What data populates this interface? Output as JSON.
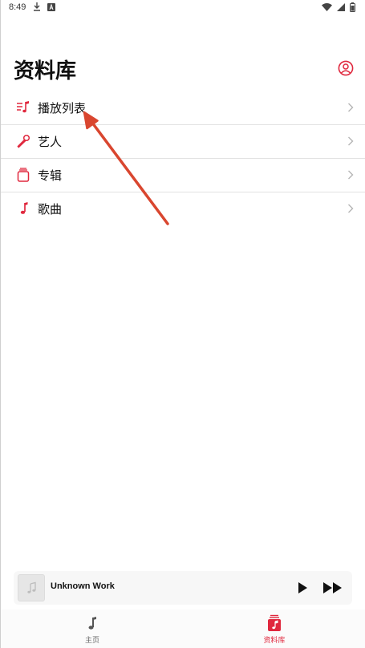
{
  "status_bar": {
    "time": "8:49",
    "left_icons": [
      "download-icon",
      "a-notification-icon"
    ],
    "right_icons": [
      "wifi-icon",
      "signal-icon",
      "battery-icon"
    ]
  },
  "header": {
    "title": "资料库",
    "account_icon": "account-circle-icon"
  },
  "library": {
    "items": [
      {
        "label": "播放列表",
        "icon": "playlist-icon"
      },
      {
        "label": "艺人",
        "icon": "microphone-icon"
      },
      {
        "label": "专辑",
        "icon": "album-icon"
      },
      {
        "label": "歌曲",
        "icon": "music-note-icon"
      }
    ]
  },
  "mini_player": {
    "title": "Unknown Work",
    "artwork_icon": "music-note-icon"
  },
  "tab_bar": {
    "tabs": [
      {
        "label": "主页",
        "icon": "home-note-icon",
        "active": false
      },
      {
        "label": "资料库",
        "icon": "library-icon",
        "active": true
      }
    ]
  },
  "colors": {
    "accent": "#e0283e",
    "arrow": "#d9462f",
    "text": "#111111",
    "divider": "#e2e2e2"
  }
}
